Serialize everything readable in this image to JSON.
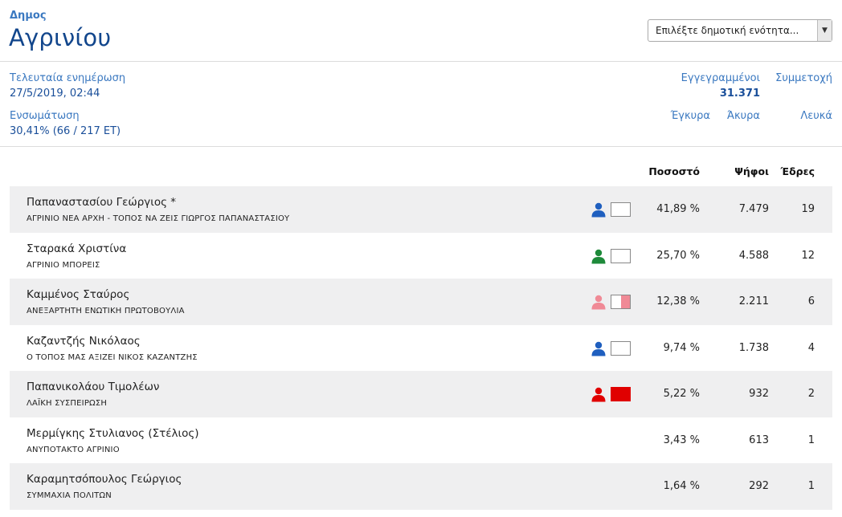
{
  "header": {
    "label": "Δημος",
    "name": "Αγρινίου",
    "select_placeholder": "Επιλέξτε δημοτική ενότητα..."
  },
  "stats": {
    "update_label": "Τελευταία ενημέρωση",
    "update_value": "27/5/2019, 02:44",
    "incorporation_label": "Ενσωμάτωση",
    "incorporation_value": "30,41% (66 / 217 ΕΤ)",
    "registered_label": "Εγγεγραμμένοι",
    "registered_value": "31.371",
    "turnout_label": "Συμμετοχή",
    "valid_label": "Έγκυρα",
    "invalid_label": "Άκυρα",
    "blank_label": "Λευκά"
  },
  "table": {
    "col_percent": "Ποσοστό",
    "col_votes": "Ψήφοι",
    "col_seats": "Έδρες",
    "rows": [
      {
        "candidate": "Παπαναστασίου Γεώργιος *",
        "party": "ΑΓΡΙΝΙΟ ΝΕΑ ΑΡΧΗ - ΤΟΠΟΣ ΝΑ ΖΕΙΣ ΓΙΩΡΓΟΣ ΠΑΠΑΝΑΣΤΑΣΙΟΥ",
        "percent": "41,89 %",
        "votes": "7.479",
        "seats": "19",
        "icon_color": "#1f5fbf",
        "swatch_color": "#ffffff",
        "swatch_type": "empty"
      },
      {
        "candidate": "Σταρακά Χριστίνα",
        "party": "ΑΓΡΙΝΙΟ ΜΠΟΡΕΙΣ",
        "percent": "25,70 %",
        "votes": "4.588",
        "seats": "12",
        "icon_color": "#1e8a3a",
        "swatch_color": "#ffffff",
        "swatch_type": "empty"
      },
      {
        "candidate": "Καμμένος Σταύρος",
        "party": "ΑΝΕΞΑΡΤΗΤΗ ΕΝΩΤΙΚΗ ΠΡΩΤΟΒΟΥΛΙΑ",
        "percent": "12,38 %",
        "votes": "2.211",
        "seats": "6",
        "icon_color": "#f08a96",
        "swatch_color": "#f08a96",
        "swatch_type": "half"
      },
      {
        "candidate": "Καζαντζής Νικόλαος",
        "party": "Ο ΤΟΠΟΣ ΜΑΣ ΑΞΙΖΕΙ ΝΙΚΟΣ ΚΑΖΑΝΤΖΗΣ",
        "percent": "9,74 %",
        "votes": "1.738",
        "seats": "4",
        "icon_color": "#1f5fbf",
        "swatch_color": "#ffffff",
        "swatch_type": "empty"
      },
      {
        "candidate": "Παπανικολάου Τιμολέων",
        "party": "ΛΑΪΚΗ ΣΥΣΠΕΙΡΩΣΗ",
        "percent": "5,22 %",
        "votes": "932",
        "seats": "2",
        "icon_color": "#e00000",
        "swatch_color": "#e00000",
        "swatch_type": "full"
      },
      {
        "candidate": "Μερμίγκης Στυλιανος (Στέλιος)",
        "party": "ΑΝΥΠΟΤΑΚΤΟ ΑΓΡΙΝΙΟ",
        "percent": "3,43 %",
        "votes": "613",
        "seats": "1",
        "icon_color": "",
        "swatch_color": "",
        "swatch_type": "none"
      },
      {
        "candidate": "Καραμητσόπουλος Γεώργιος",
        "party": "ΣΥΜΜΑΧΙΑ ΠΟΛΙΤΩΝ",
        "percent": "1,64 %",
        "votes": "292",
        "seats": "1",
        "icon_color": "",
        "swatch_color": "",
        "swatch_type": "none"
      }
    ]
  }
}
